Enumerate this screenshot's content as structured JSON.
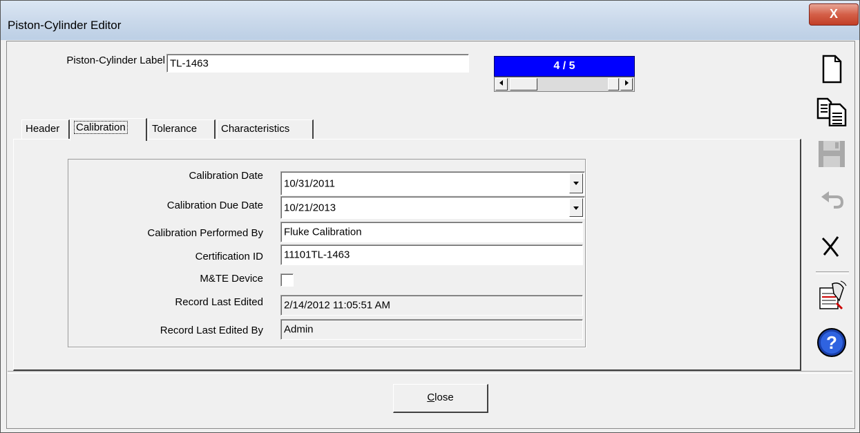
{
  "window": {
    "title": "Piston-Cylinder Editor",
    "close_glyph": "X"
  },
  "label_field": {
    "label": "Piston-Cylinder Label",
    "value": "TL-1463"
  },
  "record_nav": {
    "counter": "4 / 5",
    "position": 4,
    "total": 5,
    "counter_bg": "#0000ff"
  },
  "tabs": [
    {
      "label": "Header",
      "active": false
    },
    {
      "label": "Calibration",
      "active": true
    },
    {
      "label": "Tolerance",
      "active": false
    },
    {
      "label": "Characteristics",
      "active": false
    }
  ],
  "calibration": {
    "calibration_date": {
      "label": "Calibration Date",
      "value": "10/31/2011"
    },
    "calibration_due_date": {
      "label": "Calibration Due Date",
      "value": "10/21/2013"
    },
    "performed_by": {
      "label": "Calibration Performed By",
      "value": "Fluke Calibration"
    },
    "certification_id": {
      "label": "Certification ID",
      "value": "11101TL-1463"
    },
    "mte_device": {
      "label": "M&TE Device",
      "checked": false
    },
    "record_last_edited": {
      "label": "Record Last Edited",
      "value": "2/14/2012 11:05:51 AM"
    },
    "record_last_edited_by": {
      "label": "Record Last Edited By",
      "value": "Admin"
    }
  },
  "footer": {
    "close_label_first": "C",
    "close_label_rest": "lose"
  },
  "toolbar": [
    "new-record-icon",
    "copy-record-icon",
    "save-icon",
    "undo-icon",
    "delete-icon",
    "calibration-tool-icon",
    "help-icon"
  ]
}
